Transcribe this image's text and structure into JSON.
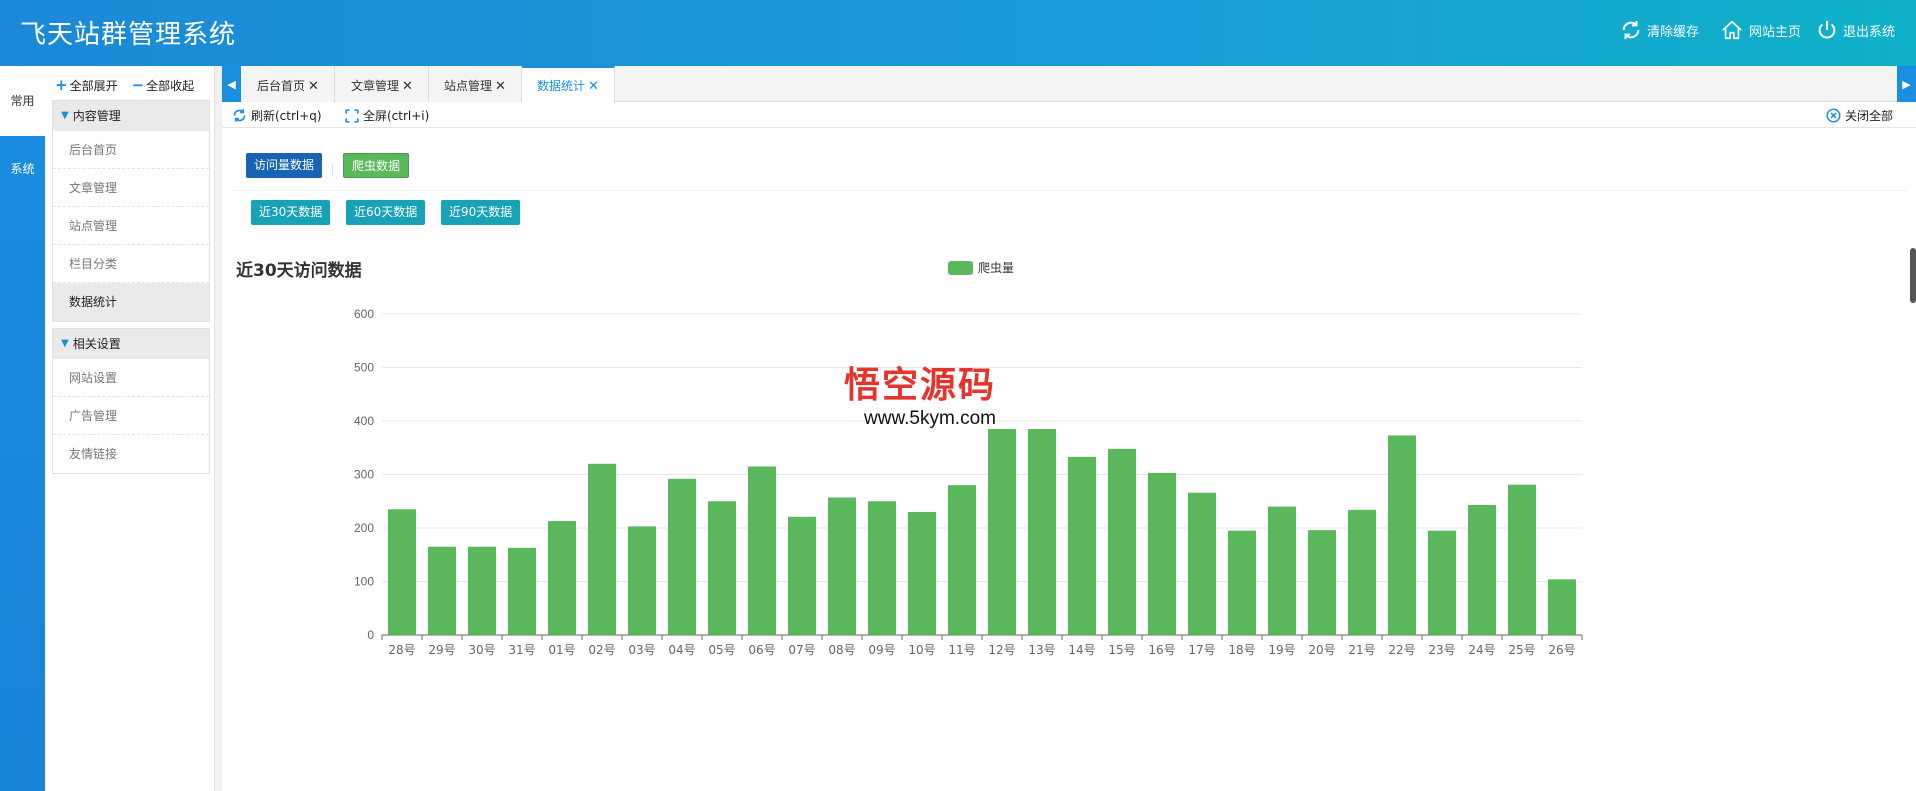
{
  "app": {
    "title": "飞天站群管理系统"
  },
  "header": {
    "clear_cache": "清除缓存",
    "site_home": "网站主页",
    "logout": "退出系统",
    "icons": [
      "refresh-icon",
      "home-icon",
      "power-icon"
    ]
  },
  "rail": {
    "tabs": [
      {
        "label": "常用"
      },
      {
        "label": "系统"
      }
    ]
  },
  "sidebar": {
    "expand_all": "全部展开",
    "collapse_all": "全部收起",
    "groups": [
      {
        "title": "内容管理",
        "items": [
          "后台首页",
          "文章管理",
          "站点管理",
          "栏目分类",
          "数据统计"
        ]
      },
      {
        "title": "相关设置",
        "items": [
          "网站设置",
          "广告管理",
          "友情链接"
        ]
      }
    ],
    "active_item": "数据统计"
  },
  "tabs": [
    {
      "label": "后台首页"
    },
    {
      "label": "文章管理"
    },
    {
      "label": "站点管理"
    },
    {
      "label": "数据统计",
      "active": true
    }
  ],
  "toolbar": {
    "refresh": "刷新(ctrl+q)",
    "fullscreen": "全屏(ctrl+i)",
    "close_all": "关闭全部"
  },
  "content": {
    "btn_visits": "访问量数据",
    "btn_crawl": "爬虫数据",
    "range_buttons": [
      "近30天数据",
      "近60天数据",
      "近90天数据"
    ]
  },
  "watermark": {
    "text": "悟空源码",
    "url": "www.5kym.com"
  },
  "chart_data": {
    "type": "bar",
    "title": "近30天访问数据",
    "legend": "爬虫量",
    "color": "#5cb85c",
    "ylim": [
      0,
      600
    ],
    "yticks": [
      0,
      100,
      200,
      300,
      400,
      500,
      600
    ],
    "categories": [
      "28号",
      "29号",
      "30号",
      "31号",
      "01号",
      "02号",
      "03号",
      "04号",
      "05号",
      "06号",
      "07号",
      "08号",
      "09号",
      "10号",
      "11号",
      "12号",
      "13号",
      "14号",
      "15号",
      "16号",
      "17号",
      "18号",
      "19号",
      "20号",
      "21号",
      "22号",
      "23号",
      "24号",
      "25号",
      "26号"
    ],
    "values": [
      235,
      165,
      165,
      163,
      213,
      320,
      203,
      292,
      250,
      315,
      221,
      257,
      250,
      230,
      280,
      385,
      385,
      333,
      348,
      303,
      266,
      195,
      240,
      196,
      234,
      373,
      195,
      243,
      281,
      104
    ]
  }
}
